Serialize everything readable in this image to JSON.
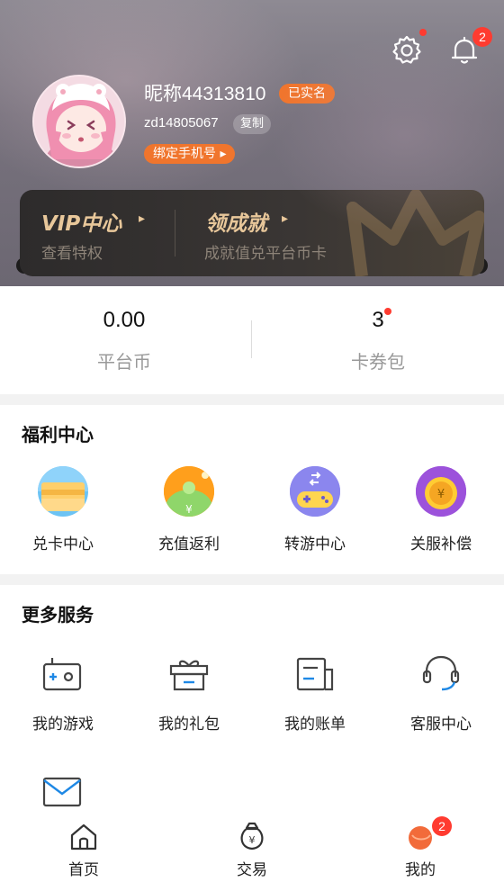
{
  "header": {
    "settings_icon": "gear-icon",
    "notification_icon": "bell-icon",
    "notification_count": "2",
    "nickname": "昵称44313810",
    "verified_tag": "已实名",
    "user_id": "zd14805067",
    "copy_label": "复制",
    "bind_phone_label": "绑定手机号 ▸"
  },
  "vip_card": {
    "vip_title": "VIP中心",
    "vip_sub": "查看特权",
    "achieve_title": "领成就",
    "achieve_sub": "成就值兑平台币卡",
    "accent_color": "#e8c79a"
  },
  "stats": [
    {
      "value": "0.00",
      "label": "平台币"
    },
    {
      "value": "3",
      "label": "卡券包"
    }
  ],
  "welfare": {
    "title": "福利中心",
    "items": [
      {
        "label": "兑卡中心",
        "icon": "card-exchange-icon"
      },
      {
        "label": "充值返利",
        "icon": "recharge-rebate-icon"
      },
      {
        "label": "转游中心",
        "icon": "game-transfer-icon"
      },
      {
        "label": "关服补偿",
        "icon": "compensation-coin-icon"
      }
    ]
  },
  "services": {
    "title": "更多服务",
    "items": [
      {
        "label": "我的游戏",
        "icon": "gamepad-icon"
      },
      {
        "label": "我的礼包",
        "icon": "gift-icon"
      },
      {
        "label": "我的账单",
        "icon": "bill-icon"
      },
      {
        "label": "客服中心",
        "icon": "headset-icon"
      }
    ],
    "extra_icon": "mail-icon"
  },
  "bottom_nav": {
    "items": [
      {
        "label": "首页",
        "icon": "home-icon"
      },
      {
        "label": "交易",
        "icon": "money-bag-icon"
      },
      {
        "label": "我的",
        "icon": "profile-icon",
        "badge": "2"
      }
    ]
  },
  "colors": {
    "accent_orange": "#f0752d",
    "badge_red": "#ff3b30"
  }
}
